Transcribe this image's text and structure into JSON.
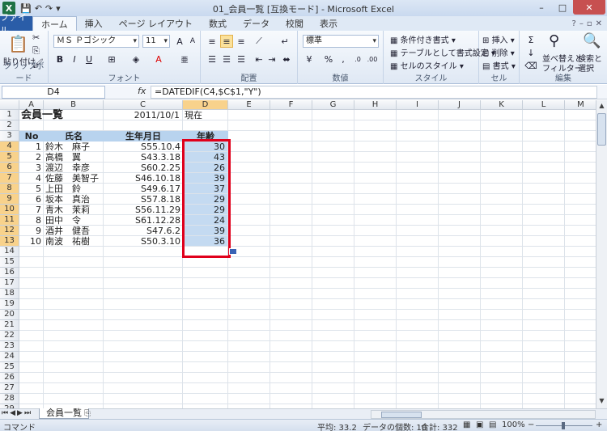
{
  "window": {
    "title": "01_会員一覧 [互換モード] - Microsoft Excel",
    "app_icon": "X",
    "controls": [
      "–",
      "□",
      "✕"
    ]
  },
  "tabs": [
    "ホーム",
    "挿入",
    "ページ レイアウト",
    "数式",
    "データ",
    "校閲",
    "表示"
  ],
  "file_tab": "ファイル",
  "ribbon": {
    "clipboard": {
      "label": "クリップボード",
      "paste": "貼り付け"
    },
    "font": {
      "label": "フォント",
      "name": "ＭＳ Ｐゴシック",
      "size": "11"
    },
    "alignment": {
      "label": "配置"
    },
    "number": {
      "label": "数値",
      "format": "標準"
    },
    "styles": {
      "label": "スタイル",
      "conditional": "条件付き書式",
      "table": "テーブルとして書式設定",
      "cell": "セルのスタイル"
    },
    "cells": {
      "label": "セル",
      "insert": "挿入",
      "delete": "削除",
      "format": "書式"
    },
    "editing": {
      "label": "編集",
      "sort": "並べ替えと",
      "filter": "フィルター",
      "find": "検索と",
      "select": "選択"
    }
  },
  "formula_bar": {
    "name_box": "D4",
    "fx": "fx",
    "formula": "=DATEDIF(C4,$C$1,\"Y\")"
  },
  "columns": [
    "A",
    "B",
    "C",
    "D",
    "E",
    "F",
    "G",
    "H",
    "I",
    "J",
    "K",
    "L",
    "M"
  ],
  "rows": [
    "1",
    "2",
    "3",
    "4",
    "5",
    "6",
    "7",
    "8",
    "9",
    "10",
    "11",
    "12",
    "13",
    "14",
    "15",
    "16",
    "17",
    "18",
    "19",
    "20",
    "21",
    "22",
    "23",
    "24",
    "25",
    "26",
    "27",
    "28",
    "29"
  ],
  "sheet": {
    "title": "会員一覧",
    "date": "2011/10/1",
    "date_suffix": "現在",
    "headers": {
      "no": "No",
      "name": "氏名",
      "birth": "生年月日",
      "age": "年齢"
    },
    "members": [
      {
        "no": "1",
        "name": "鈴木　麻子",
        "birth": "S55.10.4",
        "age": "30"
      },
      {
        "no": "2",
        "name": "高橋　翼",
        "birth": "S43.3.18",
        "age": "43"
      },
      {
        "no": "3",
        "name": "渡辺　幸彦",
        "birth": "S60.2.25",
        "age": "26"
      },
      {
        "no": "4",
        "name": "佐藤　美智子",
        "birth": "S46.10.18",
        "age": "39"
      },
      {
        "no": "5",
        "name": "上田　鈴",
        "birth": "S49.6.17",
        "age": "37"
      },
      {
        "no": "6",
        "name": "坂本　真治",
        "birth": "S57.8.18",
        "age": "29"
      },
      {
        "no": "7",
        "name": "青木　茉莉",
        "birth": "S56.11.29",
        "age": "29"
      },
      {
        "no": "8",
        "name": "田中　令",
        "birth": "S61.12.28",
        "age": "24"
      },
      {
        "no": "9",
        "name": "酒井　健吾",
        "birth": "S47.6.2",
        "age": "39"
      },
      {
        "no": "10",
        "name": "南波　祐樹",
        "birth": "S50.3.10",
        "age": "36"
      }
    ]
  },
  "sheet_tab": "会員一覧",
  "status": {
    "mode": "コマンド",
    "average": "平均: 33.2",
    "count": "データの個数: 10",
    "sum": "合計: 332",
    "zoom": "100%"
  },
  "colors": {
    "accent": "#2a5da8",
    "highlight_box": "#e0001b",
    "header_fill": "#b8d3ee",
    "selection": "#c4daf1"
  }
}
